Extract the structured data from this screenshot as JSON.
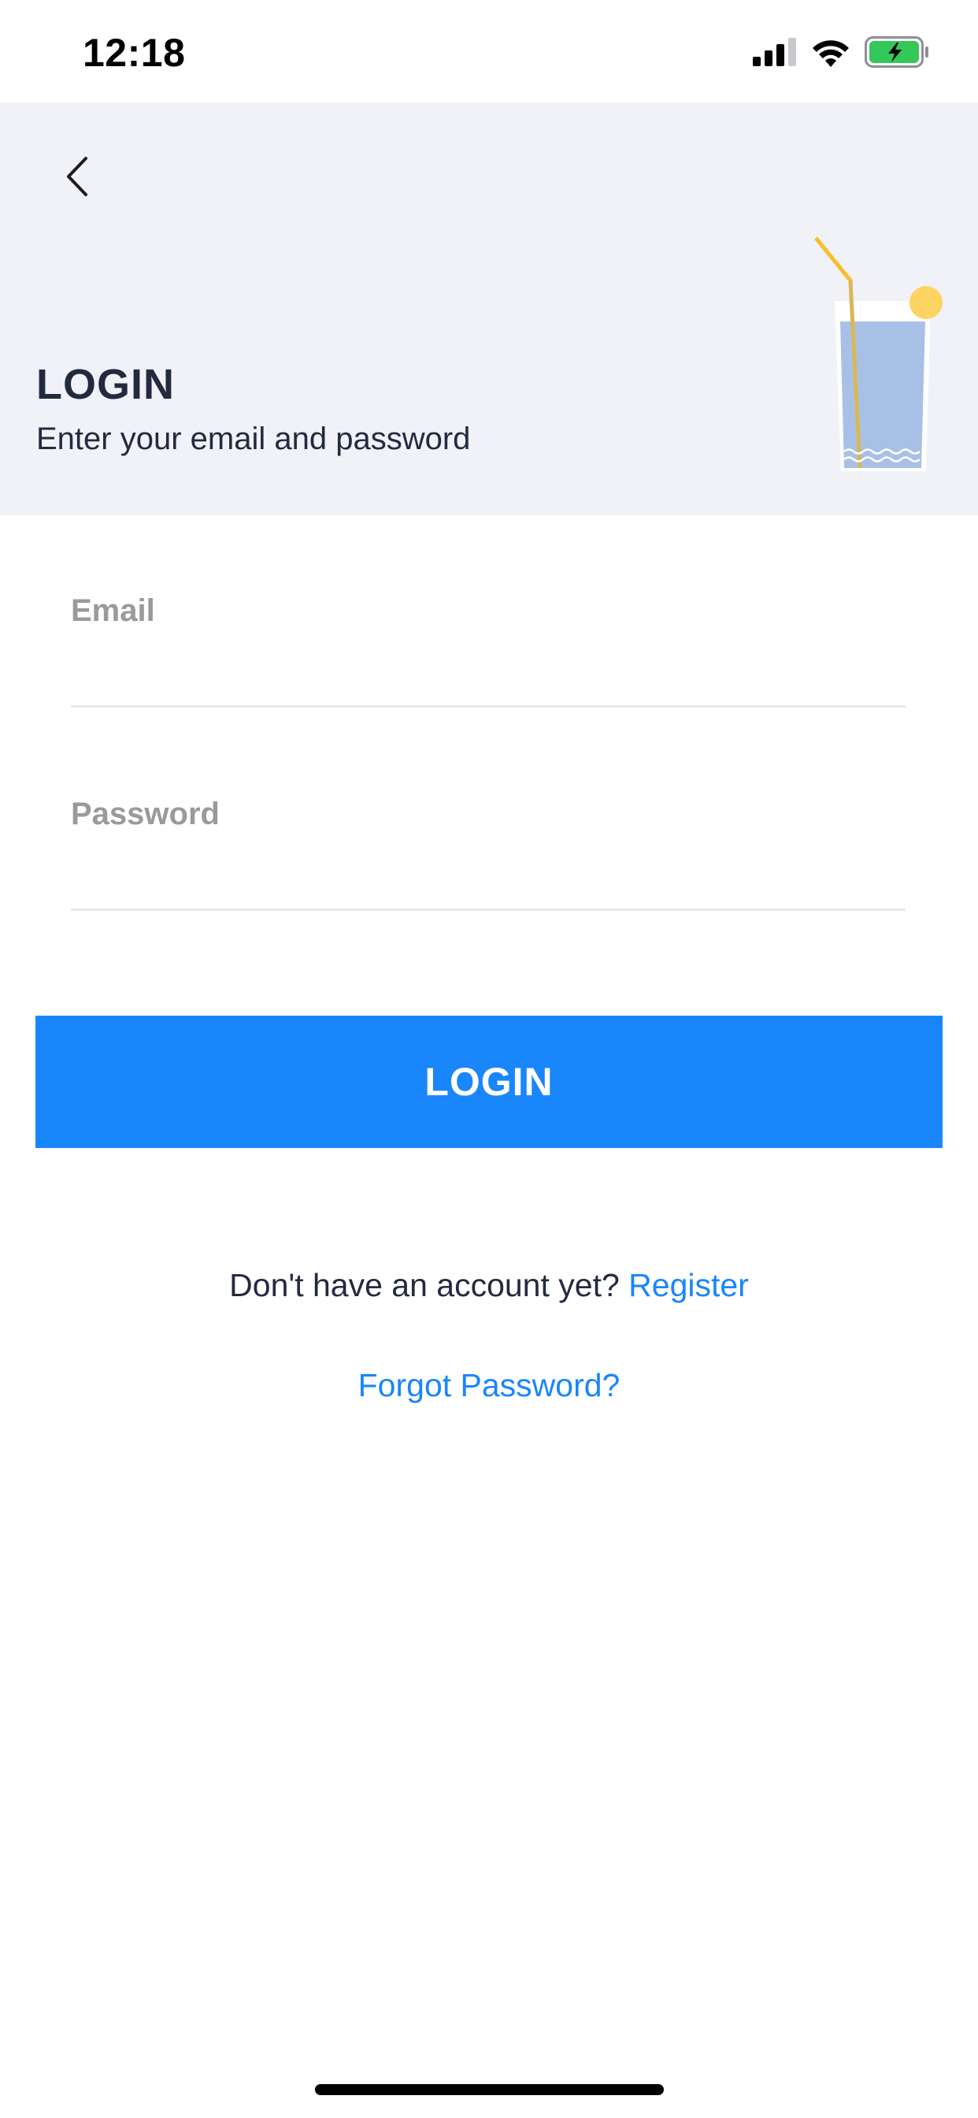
{
  "status_bar": {
    "time": "12:18",
    "icons": [
      "cellular-signal-icon",
      "wifi-icon",
      "battery-charging-icon"
    ],
    "battery_color": "#34c759"
  },
  "header": {
    "back_icon": "chevron-left-icon",
    "title": "LOGIN",
    "subtitle": "Enter your email and password",
    "illustration": "drink-glass-icon",
    "background": "#f1f2f7"
  },
  "form": {
    "email": {
      "placeholder": "Email",
      "value": ""
    },
    "password": {
      "placeholder": "Password",
      "value": ""
    },
    "submit_label": "LOGIN"
  },
  "footer": {
    "register_prompt": "Don't have an account yet?",
    "register_link": "Register",
    "forgot_link": "Forgot Password?"
  },
  "colors": {
    "accent": "#1a86fb",
    "text_dark": "#232a40",
    "placeholder": "#9a9a9a"
  }
}
